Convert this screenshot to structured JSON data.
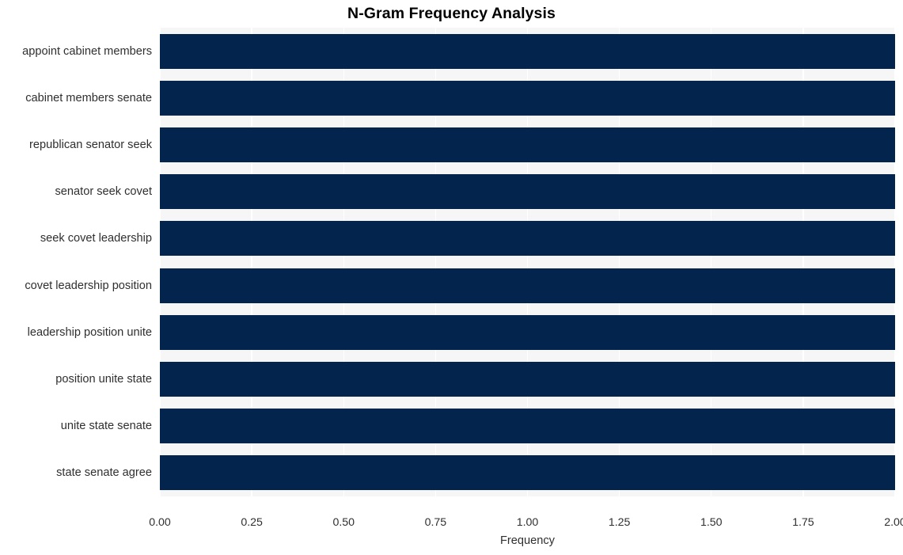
{
  "chart_data": {
    "type": "bar",
    "orientation": "horizontal",
    "title": "N-Gram Frequency Analysis",
    "xlabel": "Frequency",
    "ylabel": "",
    "categories": [
      "appoint cabinet members",
      "cabinet members senate",
      "republican senator seek",
      "senator seek covet",
      "seek covet leadership",
      "covet leadership position",
      "leadership position unite",
      "position unite state",
      "unite state senate",
      "state senate agree"
    ],
    "values": [
      2,
      2,
      2,
      2,
      2,
      2,
      2,
      2,
      2,
      2
    ],
    "xlim": [
      0,
      2
    ],
    "xticks": [
      0,
      0.25,
      0.5,
      0.75,
      1,
      1.25,
      1.5,
      1.75,
      2
    ],
    "xtick_labels": [
      "0.00",
      "0.25",
      "0.50",
      "0.75",
      "1.00",
      "1.25",
      "1.50",
      "1.75",
      "2.00"
    ],
    "grid": true,
    "grid_axis": "x",
    "legend": null,
    "colors": {
      "bar": "#03244d",
      "plot_background": "#f6f6f7",
      "figure_background": "#ffffff",
      "gridline": "#ffffff",
      "title_text": "#000000",
      "tick_text": "#2f2f2f"
    }
  }
}
